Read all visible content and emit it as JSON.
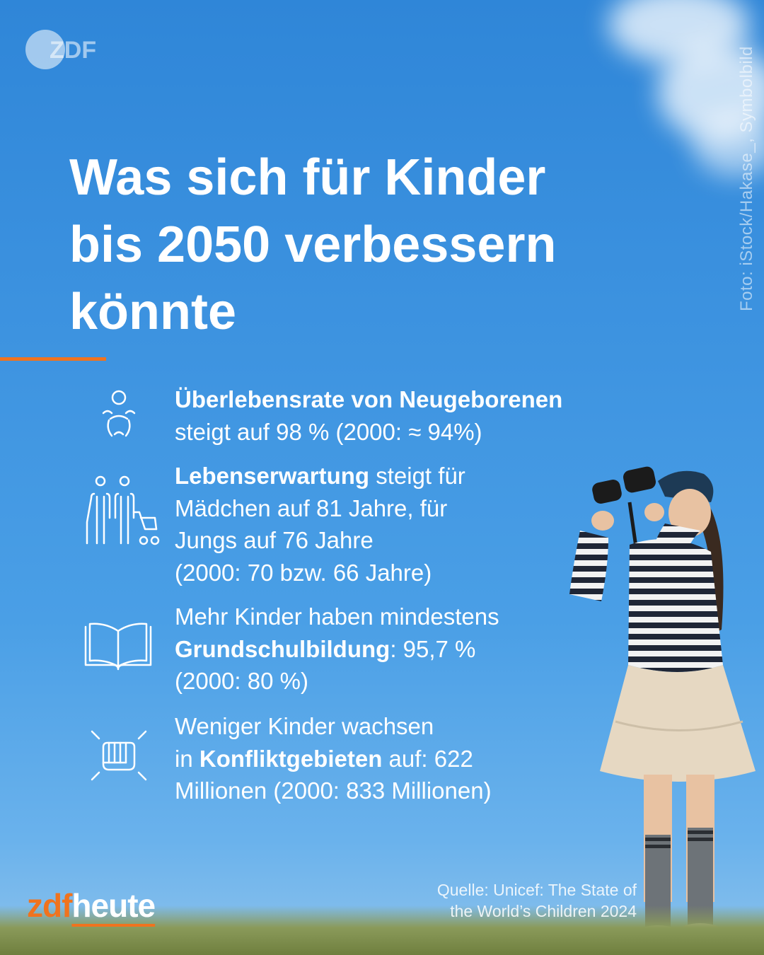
{
  "brand": {
    "top_logo": "ZDF",
    "bottom_logo_part1": "zdf",
    "bottom_logo_part2": "heute"
  },
  "photo_credit": "Foto: iStock/Hakase_, Symbolbild",
  "title": {
    "line1": "Was sich für Kinder",
    "line2": "bis 2050 verbessern",
    "line3": "könnte"
  },
  "items": [
    {
      "icon": "baby-icon",
      "bold": "Überlebensrate von Neugeborenen",
      "text": "steigt auf 98 % (2000: ≈ 94%)"
    },
    {
      "icon": "family-icon",
      "bold": "Lebenserwartung",
      "after_bold": " steigt für",
      "line2": "Mädchen auf 81 Jahre, für",
      "line3": "Jungs auf 76 Jahre",
      "line4": "(2000: 70 bzw. 66 Jahre)"
    },
    {
      "icon": "open-book-icon",
      "line1": "Mehr Kinder haben mindestens",
      "bold": "Grundschulbildung",
      "after_bold": ": 95,7 %",
      "line3": "(2000: 80 %)"
    },
    {
      "icon": "fist-icon",
      "line1": "Weniger Kinder wachsen",
      "before_bold": "in ",
      "bold": "Konfliktgebieten",
      "after_bold": " auf: 622",
      "line3": "Millionen (2000: 833 Millionen)"
    }
  ],
  "source": {
    "line1": "Quelle: Unicef: The State of",
    "line2": "the World’s Children 2024"
  },
  "colors": {
    "accent": "#f0731e",
    "sky": "#3d93e0",
    "text": "#ffffff"
  }
}
